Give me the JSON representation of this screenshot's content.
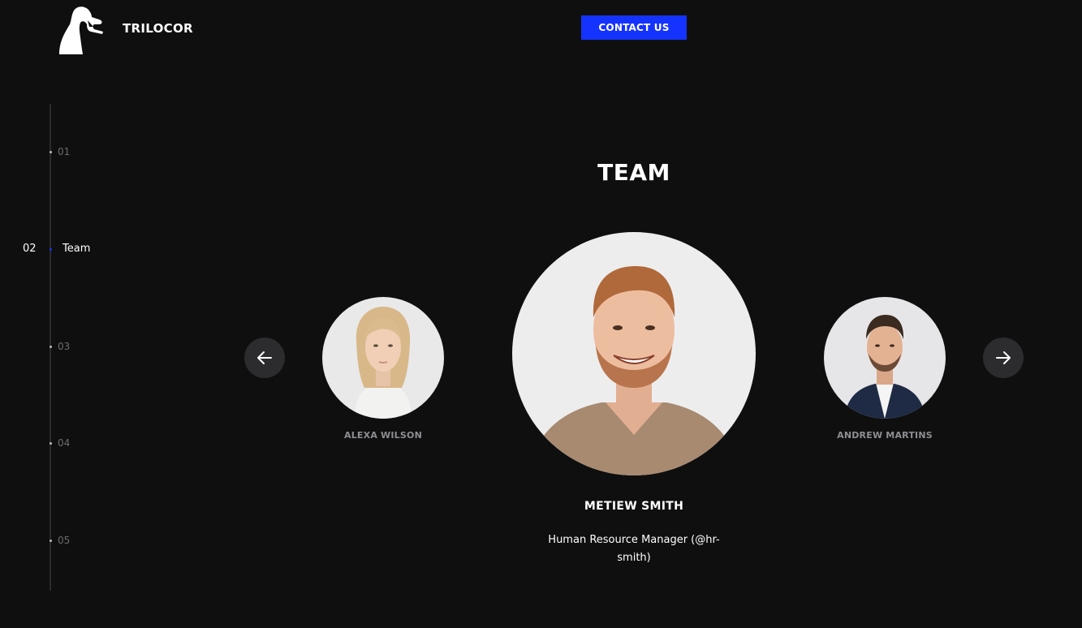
{
  "header": {
    "brand": "TRILOCOR",
    "logo_icon": "swan-logo-icon",
    "contact_label": "CONTACT US",
    "accent_color": "#1433ff"
  },
  "side_nav": {
    "items": [
      {
        "number": "01",
        "label": "",
        "active": false
      },
      {
        "number": "02",
        "label": "Team",
        "active": true
      },
      {
        "number": "03",
        "label": "",
        "active": false
      },
      {
        "number": "04",
        "label": "",
        "active": false
      },
      {
        "number": "05",
        "label": "",
        "active": false
      }
    ]
  },
  "team": {
    "title": "TEAM",
    "prev_icon": "arrow-left-icon",
    "next_icon": "arrow-right-icon",
    "members": [
      {
        "name": "ALEXA WILSON",
        "position": "left"
      },
      {
        "name": "METIEW SMITH",
        "role": "Human Resource Manager (@hr-smith)",
        "position": "center"
      },
      {
        "name": "ANDREW MARTINS",
        "position": "right"
      }
    ]
  }
}
